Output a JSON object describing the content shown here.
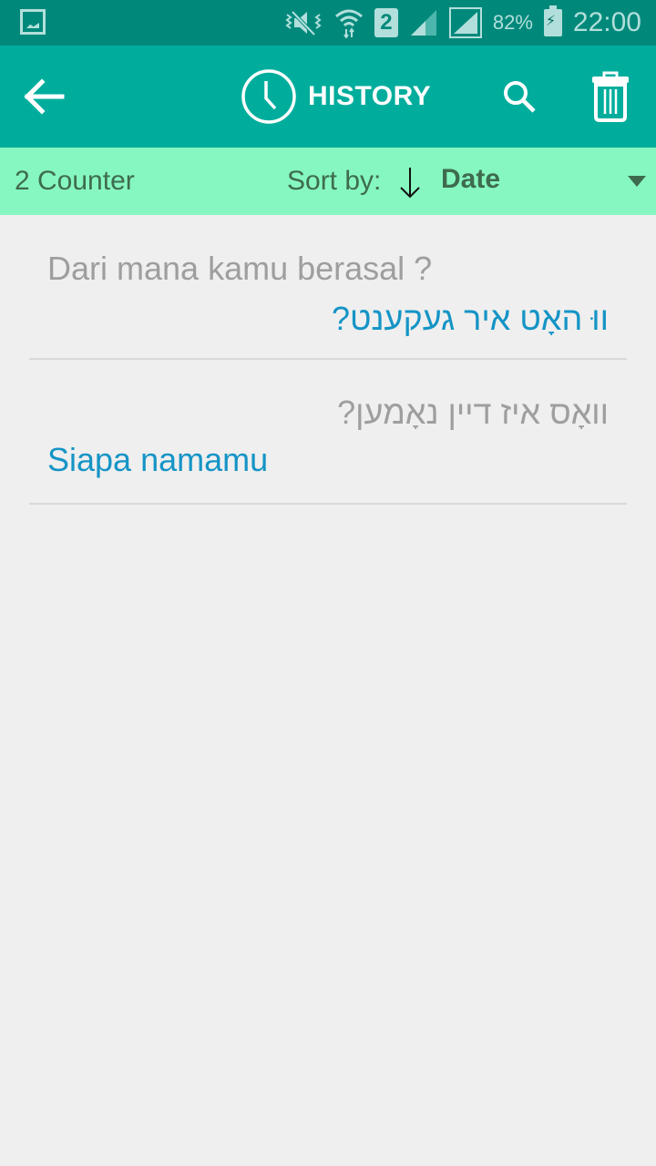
{
  "status_bar": {
    "left_icon": "gallery-notification-icon",
    "icons": [
      "vibrate-mute-icon",
      "wifi-icon",
      "sim-2-icon",
      "signal-icon",
      "signal-roaming-icon",
      "battery-charging-icon"
    ],
    "sim_label": "2",
    "battery": "82%",
    "time": "22:00"
  },
  "app_bar": {
    "title": "HISTORY",
    "back_icon": "arrow-back-icon",
    "title_icon": "clock-icon",
    "search_icon": "search-icon",
    "delete_icon": "trash-icon"
  },
  "sort_bar": {
    "counter": "2 Counter",
    "sort_label": "Sort by:",
    "sort_direction": "descending",
    "sort_value": "Date"
  },
  "history": [
    {
      "source": "Dari mana kamu berasal ?",
      "translation": "ווּ האָט איר געקענט?"
    },
    {
      "source": "וואָס איז דיין נאָמען?",
      "translation": "Siapa namamu"
    }
  ],
  "colors": {
    "status_bar": "#00897b",
    "app_bar": "#00ad9c",
    "sort_bar": "#86f7c0",
    "source_text": "#9e9e9e",
    "translation_text": "#1594c6"
  }
}
